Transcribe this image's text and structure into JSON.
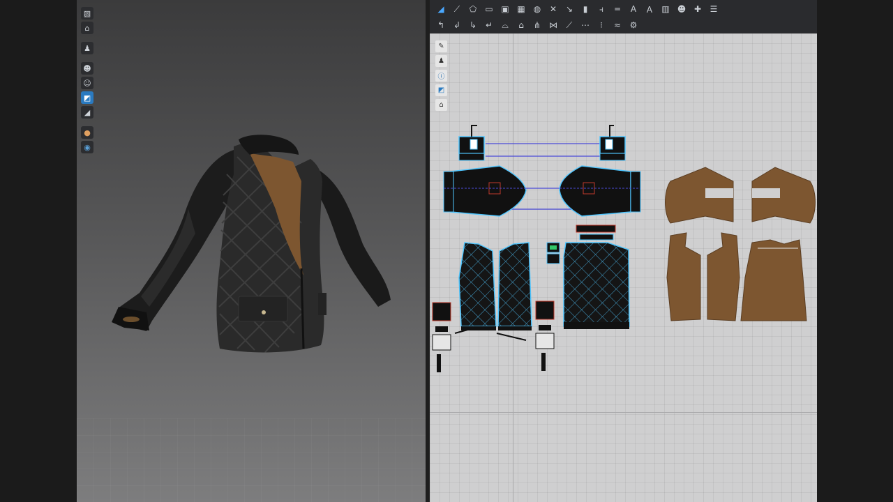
{
  "viewport_3d": {
    "toolbar_icons": [
      "cube-icon",
      "shirt-outline-icon",
      "shirt-icon",
      "avatar-color-icon",
      "avatar-icon",
      "texture-icon",
      "fold-icon",
      "skin-icon",
      "sphere-icon"
    ]
  },
  "viewport_2d": {
    "toolbar_row1_icons": [
      "transform-pattern-icon",
      "edit-pattern-icon",
      "polygon-icon",
      "rectangle-icon",
      "internal-polygon-icon",
      "internal-rect-icon",
      "circle-icon",
      "cut-icon",
      "trace-icon",
      "fold-arrangement-icon",
      "add-point-icon",
      "separator-icon",
      "text-icon",
      "text-outline-icon",
      "grid-icon",
      "avatar-color-icon",
      "pin-icon",
      "layout-icon"
    ],
    "toolbar_row2_icons": [
      "segment-sew-icon",
      "free-sew-icon",
      "multi-sew-icon",
      "tack-icon",
      "fold-icon",
      "pleat-icon",
      "zipper-icon",
      "puckering-icon",
      "measure-icon",
      "line-icon",
      "button-icon",
      "stitch-icon",
      "topstitch-icon"
    ],
    "canvas_tools": [
      "brush-icon",
      "shirt-view-icon",
      "info-icon",
      "display-icon",
      "lock-shirt-icon"
    ]
  },
  "colors": {
    "accent": "#2a7ac0",
    "fabric_black": "#141414",
    "fabric_brown": "#7d5630",
    "seam_blue": "#4a4ad8",
    "pattern_outline": "#4fc6ff",
    "canvas_bg": "#cfcfd0"
  }
}
